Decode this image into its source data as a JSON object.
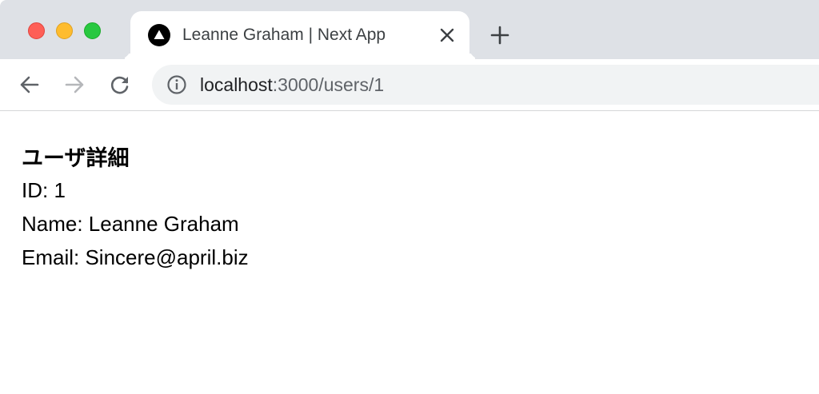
{
  "browser": {
    "tab": {
      "title": "Leanne Graham | Next App"
    },
    "address_bar": {
      "host": "localhost",
      "path": ":3000/users/1"
    },
    "icons": {
      "favicon": "nextjs-triangle-icon",
      "close": "close-icon",
      "new_tab": "plus-icon",
      "back": "arrow-left-icon",
      "forward": "arrow-right-icon",
      "reload": "reload-icon",
      "site_info": "info-icon"
    },
    "colors": {
      "tabstrip": "#dee1e6",
      "traffic_red": "#fe5f57",
      "traffic_yellow": "#febc2e",
      "traffic_green": "#28c840",
      "omnibox": "#f1f3f4"
    }
  },
  "page": {
    "heading": "ユーザ詳細",
    "id_line": "ID: 1",
    "name_line": "Name: Leanne Graham",
    "email_line": "Email: Sincere@april.biz"
  }
}
